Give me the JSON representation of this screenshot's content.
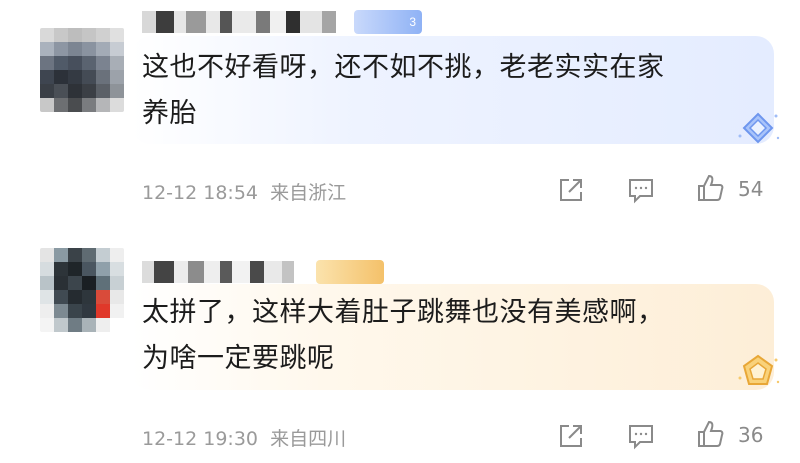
{
  "comments": [
    {
      "text_line1": "这也不好看呀，还不如不挑，老老实实在家",
      "text_line2": "养胎",
      "timestamp": "12-12 18:54",
      "location": "来自浙江",
      "like_count": "54",
      "badge_text": "3",
      "bubble_theme": "blue",
      "icons": [
        "share-icon",
        "comment-icon",
        "like-icon",
        "diamond-badge-icon"
      ]
    },
    {
      "text_line1": "太拼了，这样大着肚子跳舞也没有美感啊，",
      "text_line2": "为啥一定要跳呢",
      "timestamp": "12-12 19:30",
      "location": "来自四川",
      "like_count": "36",
      "bubble_theme": "gold",
      "icons": [
        "share-icon",
        "comment-icon",
        "like-icon",
        "pentagon-badge-icon"
      ]
    }
  ],
  "colors": {
    "text": "#1c1c1c",
    "meta": "#9a9a9a",
    "blue_bubble": "#e4ecff",
    "gold_bubble": "#fdeed7",
    "badge_blue": "#8fb2f5",
    "badge_gold": "#f7c96b"
  }
}
